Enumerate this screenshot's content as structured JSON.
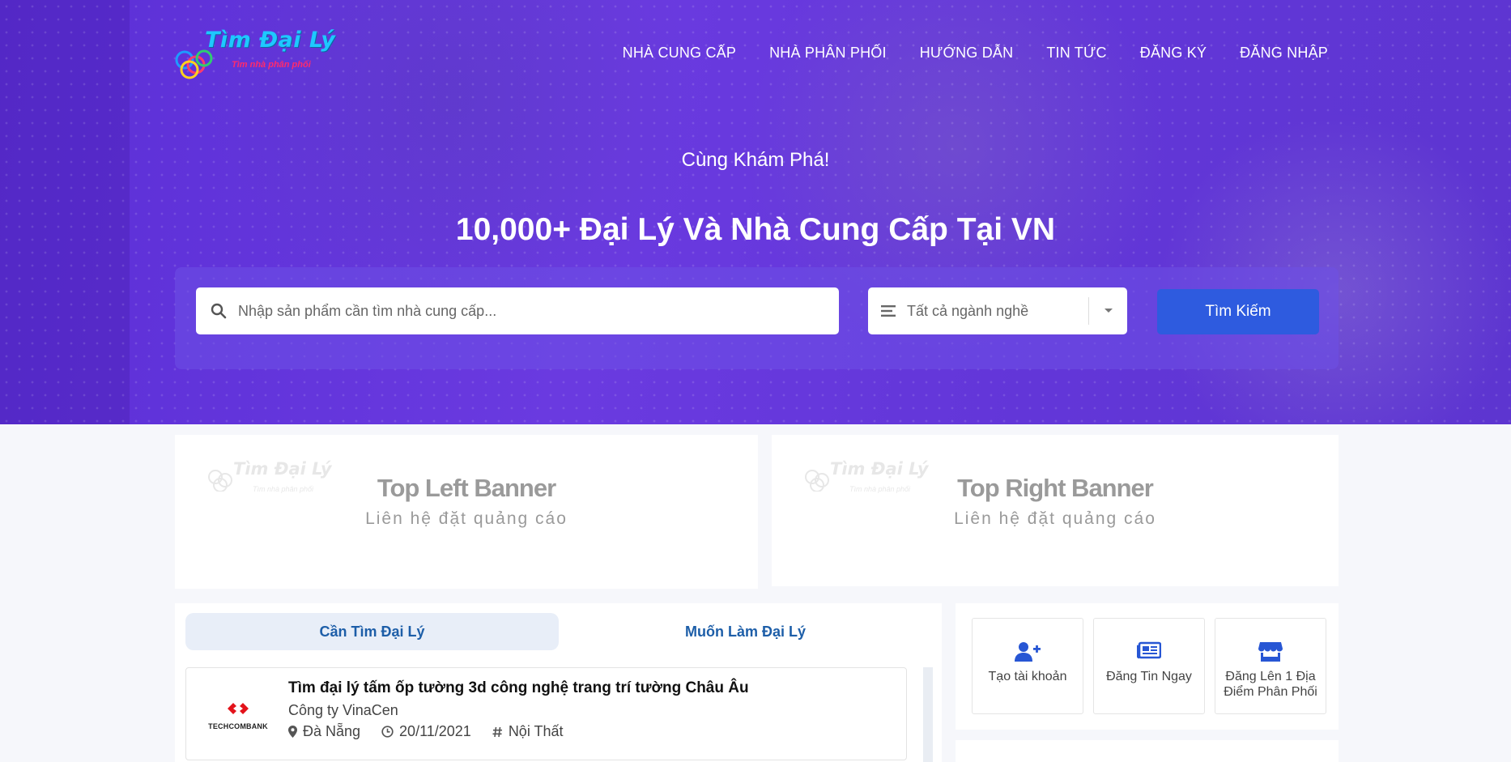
{
  "brand": {
    "name": "Tìm Đại Lý",
    "tagline": "Tìm nhà phân phối"
  },
  "nav": [
    {
      "label": "NHÀ CUNG CẤP"
    },
    {
      "label": "NHÀ PHÂN PHỐI"
    },
    {
      "label": "HƯỚNG DẪN"
    },
    {
      "label": "TIN TỨC"
    },
    {
      "label": "ĐĂNG KÝ"
    },
    {
      "label": "ĐĂNG NHẬP"
    }
  ],
  "hero": {
    "tagline": "Cùng Khám Phá!",
    "headline": "10,000+ Đại Lý Và Nhà Cung Cấp Tại VN"
  },
  "search": {
    "placeholder": "Nhập sản phẩm cần tìm nhà cung cấp...",
    "category_selected": "Tất cả ngành nghề",
    "button_label": "Tìm Kiếm"
  },
  "banners": {
    "left": {
      "title": "Top Left Banner",
      "subtitle": "Liên hệ đặt quảng cáo"
    },
    "right": {
      "title": "Top Right Banner",
      "subtitle": "Liên hệ đặt quảng cáo"
    }
  },
  "tabs": [
    {
      "label": "Cần Tìm Đại Lý",
      "active": true
    },
    {
      "label": "Muốn Làm Đại Lý",
      "active": false
    }
  ],
  "listings": [
    {
      "logo_text": "TECHCOMBANK",
      "title": "Tìm đại lý tấm ốp tường 3d công nghệ trang trí tường Châu Âu",
      "company": "Công ty VinaCen",
      "location": "Đà Nẵng",
      "date": "20/11/2021",
      "category": "Nội Thất"
    }
  ],
  "actions": [
    {
      "label": "Tạo tài khoản",
      "icon": "user-plus-icon"
    },
    {
      "label": "Đăng Tin Ngay",
      "icon": "newspaper-icon"
    },
    {
      "label": "Đăng Lên 1 Địa Điểm Phân Phối",
      "icon": "store-icon"
    }
  ],
  "colors": {
    "hero": "#6236d8",
    "accent": "#2e5bdf",
    "tab_text": "#1d5ea8",
    "action_icon": "#2756d4"
  }
}
